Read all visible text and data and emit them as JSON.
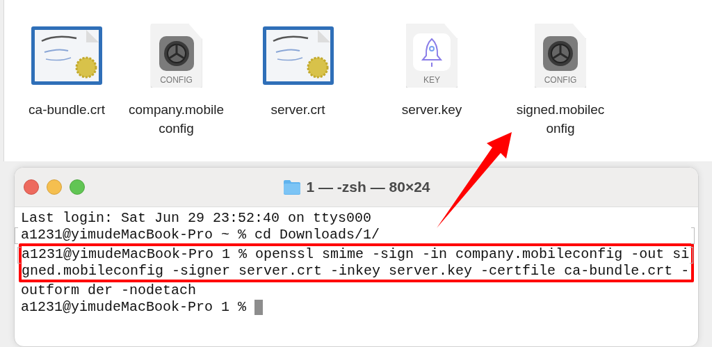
{
  "files": [
    {
      "kind": "certificate",
      "label": [
        "ca-bundle.crt"
      ]
    },
    {
      "kind": "config",
      "badge": "CONFIG",
      "label": [
        "company.mobile",
        "config"
      ]
    },
    {
      "kind": "certificate",
      "label": [
        "server.crt"
      ]
    },
    {
      "kind": "key",
      "badge": "KEY",
      "label": [
        "server.key"
      ]
    },
    {
      "kind": "config",
      "badge": "CONFIG",
      "label": [
        "signed.mobilec",
        "onfig"
      ]
    }
  ],
  "terminal": {
    "title": "1 — -zsh — 80×24",
    "lines": [
      {
        "text": "Last login: Sat Jun 29 23:52:40 on ttys000",
        "marked": false,
        "highlighted": false,
        "cursor": false
      },
      {
        "text": "a1231@yimudeMacBook-Pro ~ % cd Downloads/1/",
        "marked": true,
        "highlighted": false,
        "cursor": false
      },
      {
        "text": "a1231@yimudeMacBook-Pro 1 % openssl smime -sign -in company.mobileconfig -out si",
        "marked": true,
        "highlighted": true,
        "cursor": false
      },
      {
        "text": "gned.mobileconfig -signer server.crt -inkey server.key -certfile ca-bundle.crt -",
        "marked": false,
        "highlighted": true,
        "cursor": false
      },
      {
        "text": "outform der -nodetach",
        "marked": false,
        "highlighted": false,
        "cursor": false
      },
      {
        "text": "a1231@yimudeMacBook-Pro 1 % ",
        "marked": false,
        "highlighted": false,
        "cursor": true
      }
    ]
  }
}
